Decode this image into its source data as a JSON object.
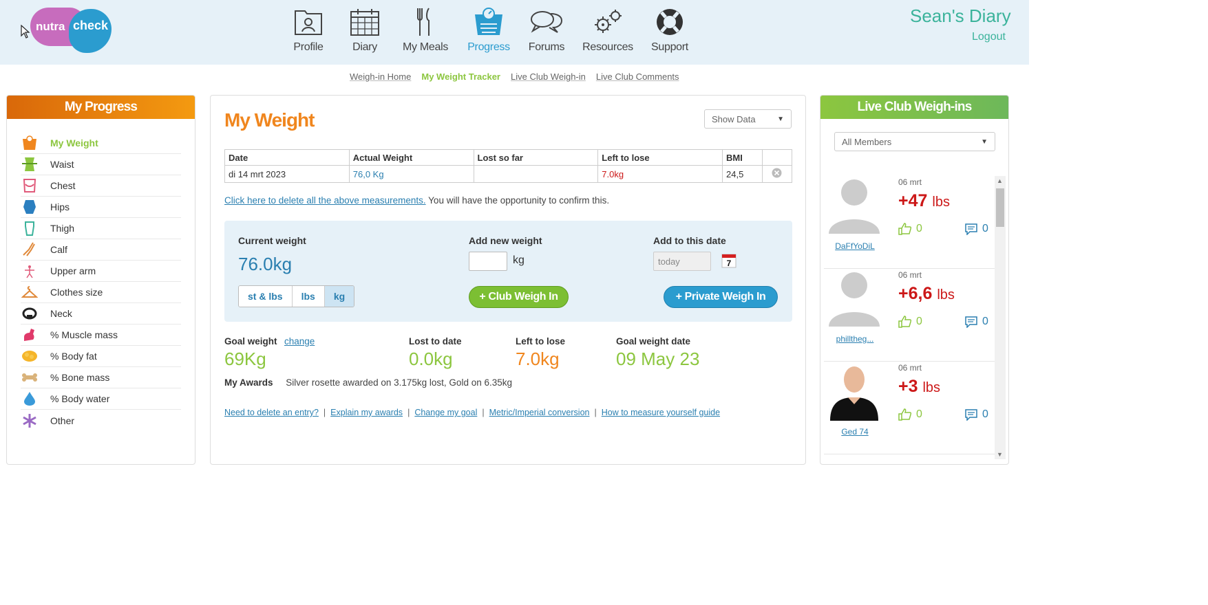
{
  "logo": {
    "part1": "nutra",
    "part2": "check"
  },
  "topnav": [
    {
      "label": "Profile",
      "icon": "profile-icon"
    },
    {
      "label": "Diary",
      "icon": "calendar-icon"
    },
    {
      "label": "My Meals",
      "icon": "cutlery-icon"
    },
    {
      "label": "Progress",
      "icon": "scale-icon",
      "active": true
    },
    {
      "label": "Forums",
      "icon": "chat-bubbles-icon"
    },
    {
      "label": "Resources",
      "icon": "gears-icon"
    },
    {
      "label": "Support",
      "icon": "lifebuoy-icon"
    }
  ],
  "user": {
    "diary_title": "Sean's Diary",
    "logout": "Logout"
  },
  "subnav": {
    "home": "Weigh-in Home",
    "tracker": "My Weight Tracker",
    "club": "Live Club Weigh-in",
    "comments": "Live Club Comments"
  },
  "left_panel": {
    "title": "My Progress",
    "items": [
      {
        "label": "My Weight",
        "active": true
      },
      {
        "label": "Waist"
      },
      {
        "label": "Chest"
      },
      {
        "label": "Hips"
      },
      {
        "label": "Thigh"
      },
      {
        "label": "Calf"
      },
      {
        "label": "Upper arm"
      },
      {
        "label": "Clothes size"
      },
      {
        "label": "Neck"
      },
      {
        "label": "% Muscle mass"
      },
      {
        "label": "% Body fat"
      },
      {
        "label": "% Bone mass"
      },
      {
        "label": "% Body water"
      },
      {
        "label": "Other"
      }
    ]
  },
  "main": {
    "title": "My Weight",
    "show_data": "Show Data",
    "table": {
      "headers": [
        "Date",
        "Actual Weight",
        "Lost so far",
        "Left to lose",
        "BMI",
        ""
      ],
      "rows": [
        {
          "date": "di 14 mrt 2023",
          "actual": "76,0 Kg",
          "lost": "",
          "left": "7.0kg",
          "bmi": "24,5"
        }
      ]
    },
    "delete_link": "Click here to delete all the above measurements.",
    "delete_note": "You will have the opportunity to confirm this.",
    "current_weight_label": "Current weight",
    "current_weight": "76.0kg",
    "units": [
      "st & lbs",
      "lbs",
      "kg"
    ],
    "selected_unit": "kg",
    "add_new_label": "Add new weight",
    "add_new_value": "",
    "add_new_unit": "kg",
    "add_date_label": "Add to this date",
    "add_date_placeholder": "today",
    "calendar_day": "7",
    "club_button": "+ Club Weigh In",
    "private_button": "+ Private Weigh In",
    "goal_label": "Goal weight",
    "goal_change": "change",
    "goal_value": "69Kg",
    "lost_label": "Lost to date",
    "lost_value": "0.0kg",
    "left_label": "Left to lose",
    "left_value": "7.0kg",
    "goal_date_label": "Goal weight date",
    "goal_date_value": "09 May 23",
    "awards_label": "My Awards",
    "awards_text": "Silver rosette awarded on 3.175kg lost, Gold on 6.35kg",
    "links": [
      "Need to delete an entry?",
      "Explain my awards",
      "Change my goal",
      "Metric/Imperial conversion",
      "How to measure yourself guide"
    ],
    "link_separator": "|"
  },
  "right_panel": {
    "title": "Live Club Weigh-ins",
    "filter": "All Members",
    "entries": [
      {
        "user": "DaFfYoDiL",
        "date": "06 mrt",
        "value": "+47",
        "unit": "lbs",
        "likes": "0",
        "comments": "0",
        "avatar": "placeholder"
      },
      {
        "user": "philltheg...",
        "date": "06 mrt",
        "value": "+6,6",
        "unit": "lbs",
        "likes": "0",
        "comments": "0",
        "avatar": "placeholder"
      },
      {
        "user": "Ged 74",
        "date": "06 mrt",
        "value": "+3",
        "unit": "lbs",
        "likes": "0",
        "comments": "0",
        "avatar": "photo"
      }
    ]
  },
  "colors": {
    "brand_green": "#8cc63f",
    "brand_blue": "#2b9ccf",
    "brand_orange": "#f0861e",
    "loss_red": "#cc1818",
    "teal_title": "#3bb39b"
  }
}
